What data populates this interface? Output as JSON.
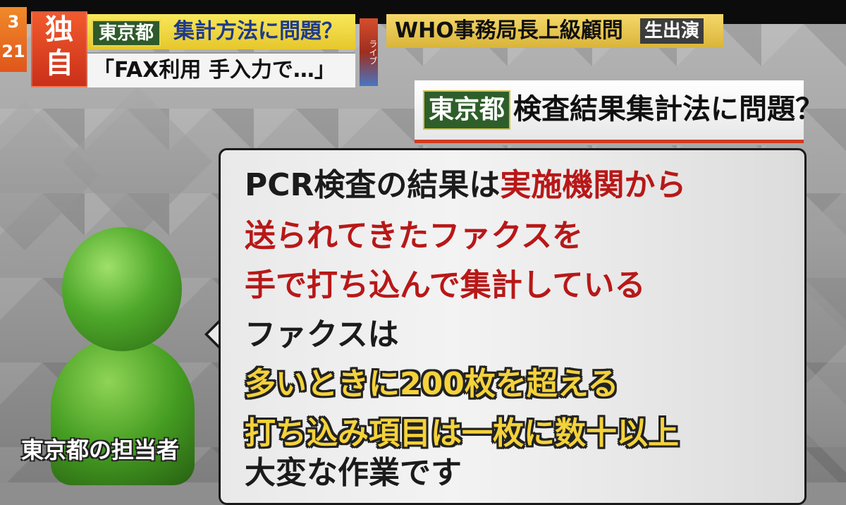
{
  "ticker": {
    "corner_top": "3",
    "corner_bottom": "21",
    "exclusive_top": "独",
    "exclusive_bottom": "自",
    "tag": "東京都",
    "title": "集計方法に問題？",
    "subtitle": "「FAX利用  手入力で…」",
    "side_strip": "ライブ"
  },
  "who": {
    "text": "WHO事務局長上級顧問",
    "live_label": "生出演"
  },
  "headline": {
    "tag": "東京都",
    "text": "検査結果集計法に問題？"
  },
  "speaker": {
    "caption": "東京都の担当者"
  },
  "bubble": {
    "lines": [
      {
        "text": "PCR検査の結果は",
        "color": "black"
      },
      {
        "text": "実施機関から",
        "color": "red"
      },
      {
        "text": "送られてきたファクスを",
        "color": "red"
      },
      {
        "text": "手で打ち込んで集計している",
        "color": "red"
      },
      {
        "text": "ファクスは",
        "color": "black"
      },
      {
        "text": "多いときに200枚を超える",
        "color": "yellow"
      },
      {
        "text": "打ち込み項目は一枚に数十以上",
        "color": "yellow"
      },
      {
        "text": "大変な作業です",
        "color": "black"
      }
    ]
  },
  "colors": {
    "accent_red": "#b81818",
    "accent_yellow": "#f4d23a",
    "tag_green": "#2e5f2a",
    "icon_green": "#4ea82a"
  }
}
